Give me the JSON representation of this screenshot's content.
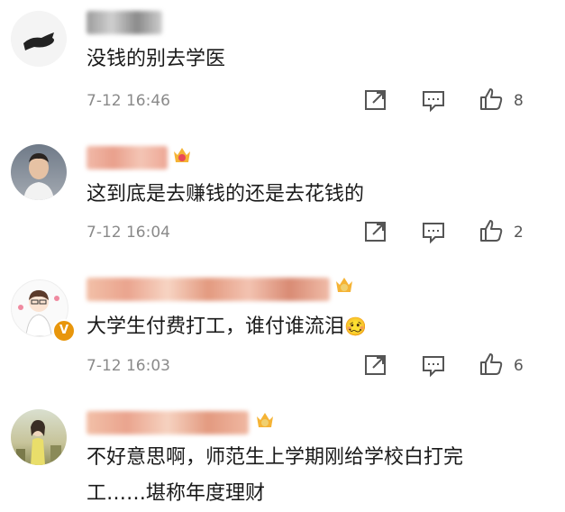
{
  "comments": [
    {
      "text": "没钱的别去学医",
      "time": "7-12 16:46",
      "likes": "8"
    },
    {
      "text": "这到底是去赚钱的还是去花钱的",
      "time": "7-12 16:04",
      "likes": "2"
    },
    {
      "text": "大学生付费打工，谁付谁流泪",
      "emoji": "🥴",
      "time": "7-12 16:03",
      "likes": "6",
      "verified_badge": "V"
    },
    {
      "text_line1": "不好意思啊，师范生上学期刚给学校白打完",
      "text_line2": "工……堪称年度理财"
    }
  ],
  "colors": {
    "time": "#8a8a8a",
    "icon": "#555555",
    "badge": "#e8960c"
  },
  "icons": [
    "share-icon",
    "comment-icon",
    "like-icon"
  ]
}
